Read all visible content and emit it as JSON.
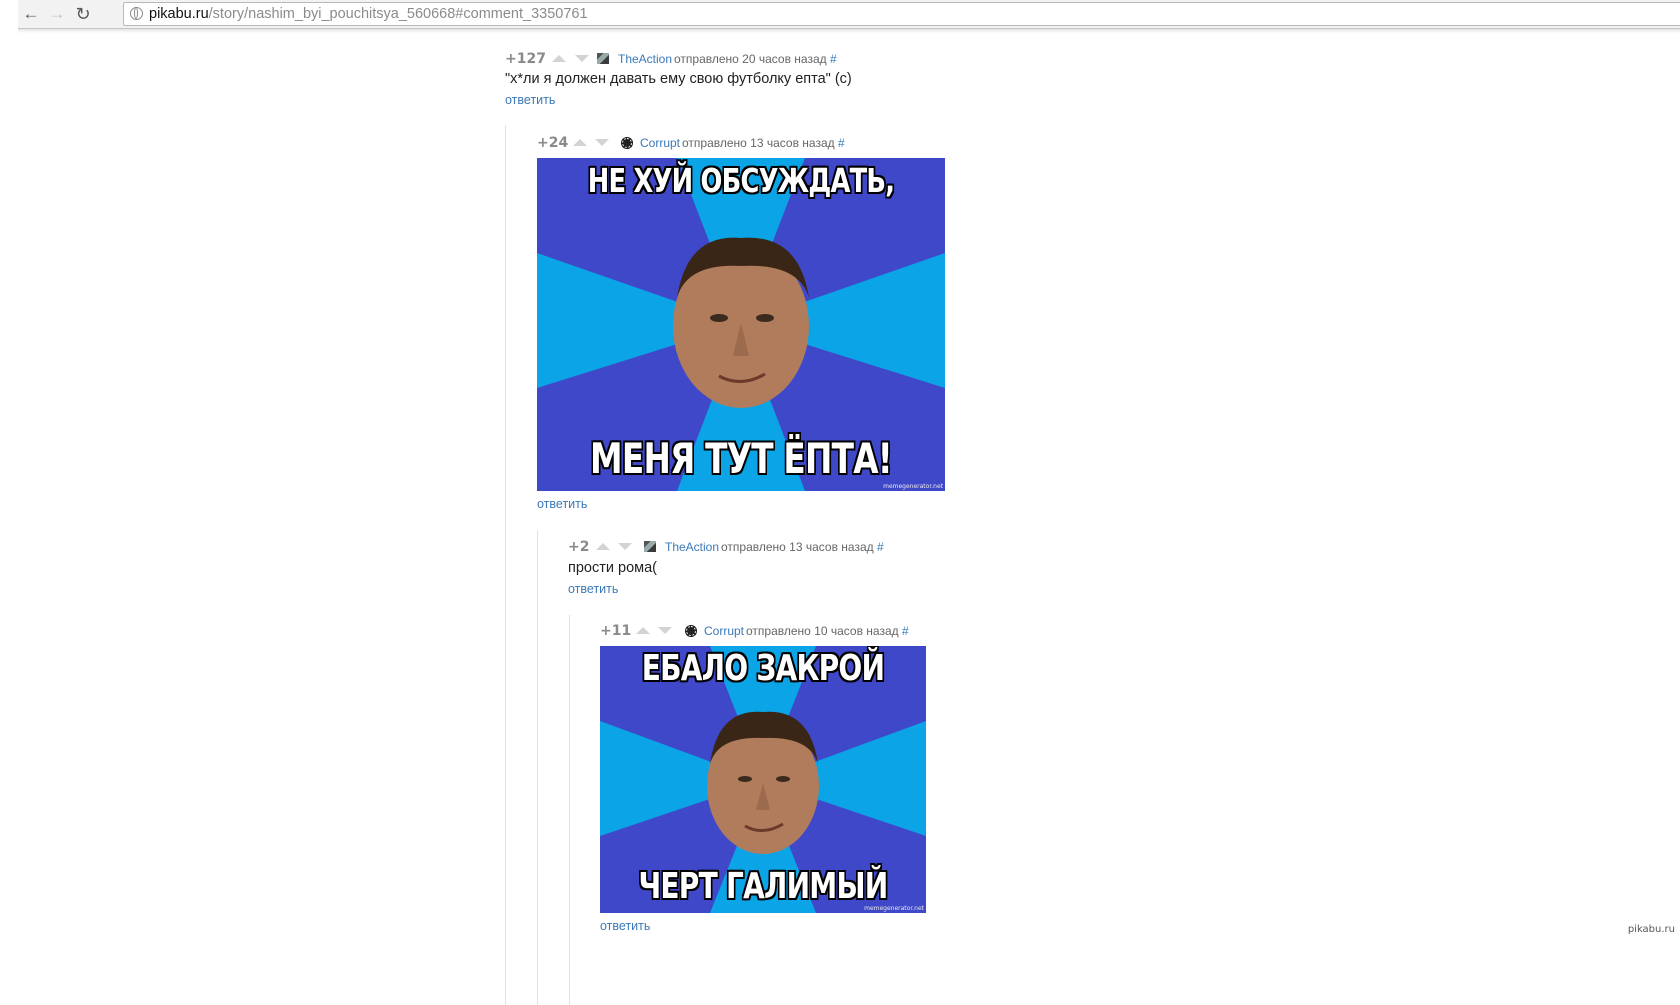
{
  "browser": {
    "back_icon": "arrow-left-icon",
    "forward_icon": "arrow-right-icon",
    "reload_icon": "reload-icon",
    "url_host": "pikabu.ru",
    "url_path": "/story/nashim_byi_pouchitsya_560668#comment_3350761"
  },
  "comments": [
    {
      "rating": "+127",
      "author": "TheAction",
      "posted": "отправлено 20 часов назад",
      "anchor": "#",
      "text": "\"х*ли я должен давать ему свою футболку епта\" (с)",
      "reply": "ответить"
    },
    {
      "rating": "+24",
      "author": "Corrupt",
      "posted": "отправлено 13 часов назад",
      "anchor": "#",
      "image": {
        "top_text": "НЕ ХУЙ ОБСУЖДАТЬ,",
        "bottom_text": "МЕНЯ ТУТ ЁПТА!",
        "watermark": "memegenerator.net"
      },
      "reply": "ответить"
    },
    {
      "rating": "+2",
      "author": "TheAction",
      "posted": "отправлено 13 часов назад",
      "anchor": "#",
      "text": "прости рома(",
      "reply": "ответить"
    },
    {
      "rating": "+11",
      "author": "Corrupt",
      "posted": "отправлено 10 часов назад",
      "anchor": "#",
      "image": {
        "top_text": "ЕБАЛО ЗАКРОЙ",
        "bottom_text": "ЧЕРТ ГАЛИМЫЙ",
        "watermark": "memegenerator.net"
      },
      "reply": "ответить"
    }
  ],
  "site_watermark": "pikabu.ru"
}
